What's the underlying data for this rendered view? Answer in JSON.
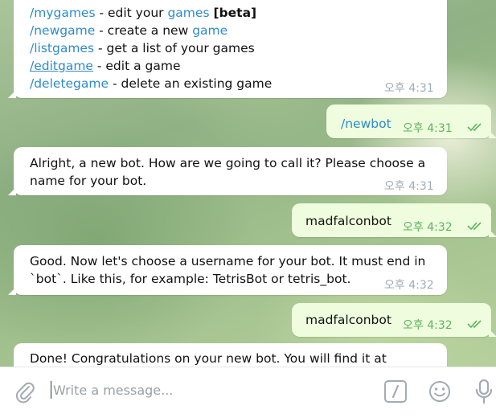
{
  "messages": [
    {
      "lines": [
        [
          {
            "text": "/mygames",
            "style": "cmd"
          },
          {
            "text": " - edit your "
          },
          {
            "text": "games",
            "style": "cmd"
          },
          {
            "text": " "
          },
          {
            "text": "[beta]",
            "style": "bold"
          }
        ],
        [
          {
            "text": "/newgame",
            "style": "cmd"
          },
          {
            "text": " - create a new "
          },
          {
            "text": "game",
            "style": "cmd"
          }
        ],
        [
          {
            "text": "/listgames",
            "style": "cmd"
          },
          {
            "text": " - get a list of your games"
          }
        ],
        [
          {
            "text": "/editgame",
            "style": "link"
          },
          {
            "text": " - edit a game"
          }
        ],
        [
          {
            "text": "/deletegame",
            "style": "cmd"
          },
          {
            "text": " - delete an existing game"
          }
        ]
      ],
      "time": "오후 4:31"
    },
    {
      "text": "/newbot",
      "time": "오후 4:31"
    },
    {
      "lines": [
        "Alright, a new bot. How are we going to call it? Please choose a",
        "name for your bot."
      ],
      "time": "오후 4:31"
    },
    {
      "text": "madfalconbot",
      "time": "오후 4:32"
    },
    {
      "lines": [
        "Good. Now let's choose a username for your bot. It must end in",
        "`bot`. Like this, for example: TetrisBot or tetris_bot."
      ],
      "time": "오후 4:32"
    },
    {
      "text": "madfalconbot",
      "time": "오후 4:32"
    },
    {
      "lines": [
        "Done! Congratulations on your new bot. You will find it at"
      ]
    }
  ],
  "composer": {
    "placeholder": "Write a message...",
    "icons": [
      "paperclip-icon",
      "bot-commands-icon",
      "emoji-icon",
      "microphone-icon"
    ]
  },
  "colors": {
    "incoming_bubble": "#ffffff",
    "outgoing_bubble": "#effdde",
    "link": "#2e8bc9",
    "outgoing_time": "#5eb35e",
    "incoming_time": "#a0acb6"
  }
}
